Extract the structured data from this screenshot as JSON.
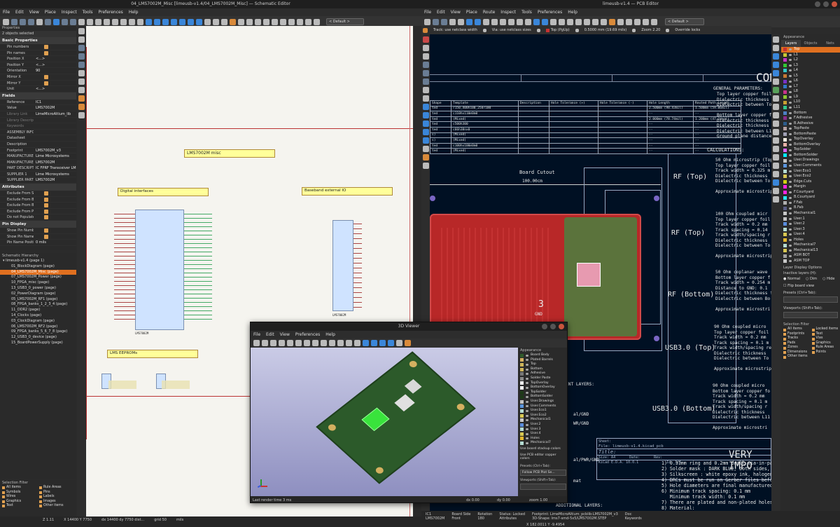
{
  "schematic": {
    "title": "04_LMS7002M_Misc [limeusb-v1.4/04_LMS7002M_Misc] — Schematic Editor",
    "menu": [
      "File",
      "Edit",
      "View",
      "Place",
      "Inspect",
      "Tools",
      "Preferences",
      "Help"
    ],
    "properties": {
      "header": "Properties",
      "selected": "2 objects selected",
      "basic_title": "Basic Properties",
      "basic": [
        {
          "k": "Pin numbers",
          "v": "",
          "check": true
        },
        {
          "k": "Pin names",
          "v": "",
          "check": true
        },
        {
          "k": "Position X",
          "v": "<...>"
        },
        {
          "k": "Position Y",
          "v": "<...>"
        },
        {
          "k": "Orientation",
          "v": "90"
        },
        {
          "k": "Mirror X",
          "v": "",
          "check": true
        },
        {
          "k": "Mirror Y",
          "v": "",
          "check": true
        },
        {
          "k": "Unit",
          "v": "<...>"
        }
      ],
      "fields_title": "Fields",
      "fields": [
        {
          "k": "Reference",
          "v": "IC1"
        },
        {
          "k": "Value",
          "v": "LMS7002M"
        },
        {
          "k": "Library Link",
          "v": "LimeMicroAltium_lib",
          "dim": true
        },
        {
          "k": "Library Description",
          "v": "",
          "dim": true
        },
        {
          "k": "Keywords",
          "v": "",
          "dim": true
        },
        {
          "k": "ASSEMBLY INFO",
          "v": ""
        },
        {
          "k": "Datasheet",
          "v": ""
        },
        {
          "k": "Description",
          "v": ""
        },
        {
          "k": "Footprint",
          "v": "LMS7002M_v3"
        },
        {
          "k": "MANUFACTURER",
          "v": "Lime Microsystems"
        },
        {
          "k": "MANUFACTURER PART",
          "v": "LMS7002M"
        },
        {
          "k": "PART DESCRIPTION",
          "v": "IC FPRF Transceiver LM"
        },
        {
          "k": "SUPPLIER 1",
          "v": "Lime Microsystems"
        },
        {
          "k": "SUPPLIER PART N",
          "v": "LMS7002M"
        }
      ],
      "attr_title": "Attributes",
      "attributes": [
        {
          "k": "Exclude From Sim",
          "v": "",
          "check": true
        },
        {
          "k": "Exclude From Bill",
          "v": "",
          "check": true
        },
        {
          "k": "Exclude From Board",
          "v": "",
          "check": true
        },
        {
          "k": "Exclude From Posi",
          "v": "",
          "check": true
        },
        {
          "k": "Do not Populate",
          "v": "",
          "check": true
        }
      ],
      "pin_title": "Pin Display",
      "pin_display": [
        {
          "k": "Show Pin Number",
          "v": "",
          "check": true
        },
        {
          "k": "Show Pin Name",
          "v": "",
          "check": true
        },
        {
          "k": "Pin Name Position",
          "v": "0 mils"
        }
      ]
    },
    "hierarchy": {
      "header": "Schematic Hierarchy",
      "root": "limeusb-v1.4 (page 1)",
      "items": [
        "01_BlockDiagram (page)",
        "04_LMS7002M_Misc (page)",
        "07_LMS7002M_Power (page)",
        "10_FPGA_misc (page)",
        "13_USB3_0_power (page)",
        "02_PowerDiagram (page)",
        "05_LMS7002M_RF1 (page)",
        "08_FPGA_banks_1_2_3_4 (page)",
        "11_DDR2 (page)",
        "14_Clocks (page)",
        "03_ClockDiagram (page)",
        "06_LMS7002M_RF2 (page)",
        "09_FPGA_banks_5_6_7_8 (page)",
        "12_USB3_0_device (page)",
        "15_BoardPowerSupply (page)"
      ],
      "selected_index": 1
    },
    "selection_filter": {
      "header": "Selection Filter",
      "items": [
        "All items",
        "Rule Areas",
        "Symbols",
        "Pins",
        "Wires",
        "Labels",
        "Graphics",
        "Images",
        "Text",
        "Other items"
      ]
    },
    "sheet_labels": {
      "misc": "LMS7002M misc",
      "digital": "Digital interfaces",
      "baseband": "Baseband external IO",
      "eeproms": "LMS EEPROMs"
    },
    "chip_labels": {
      "main": "LMS7002M",
      "baseband": "LMS7002M"
    },
    "status": [
      "Z 1.11",
      "X 14400 Y 7750",
      "dx 14400 dy 7750 dist...",
      "grid 50",
      "mils"
    ],
    "zoom_select": "< Default >"
  },
  "pcb": {
    "title": "limeusb-v1.4 — PCB Editor",
    "menu": [
      "File",
      "Edit",
      "View",
      "Place",
      "Route",
      "Inspect",
      "Tools",
      "Preferences",
      "Help"
    ],
    "toolbar": {
      "track": "Track: use netclass width",
      "via": "Via: use netclass sizes",
      "layer": "Top (PgUp)",
      "grid": "0.5000 mm (19.69 mils)",
      "zoom": "Zoom 2.20",
      "override": "Override locks",
      "default": "< Default >"
    },
    "appearance": {
      "header": "Appearance",
      "tabs": [
        "Layers",
        "Objects",
        "Nets"
      ],
      "layers": [
        {
          "n": "Top",
          "c": "#c83232"
        },
        {
          "n": "L1",
          "c": "#c8c832"
        },
        {
          "n": "L2",
          "c": "#c832c8"
        },
        {
          "n": "L3",
          "c": "#32c832"
        },
        {
          "n": "L4",
          "c": "#32c8c8"
        },
        {
          "n": "L5",
          "c": "#c87832"
        },
        {
          "n": "L6",
          "c": "#7832c8"
        },
        {
          "n": "L7",
          "c": "#3278c8"
        },
        {
          "n": "L8",
          "c": "#c8328c"
        },
        {
          "n": "L9",
          "c": "#8cc832"
        },
        {
          "n": "L10",
          "c": "#c8a032"
        },
        {
          "n": "L11",
          "c": "#32c88c"
        },
        {
          "n": "Bottom",
          "c": "#4d7fc4"
        },
        {
          "n": "F.Adhesive",
          "c": "#8b2d8b"
        },
        {
          "n": "B.Adhesive",
          "c": "#2d5c8b"
        },
        {
          "n": "TopPaste",
          "c": "#b4a0a0"
        },
        {
          "n": "BottomPaste",
          "c": "#a0a0b4"
        },
        {
          "n": "TopOverlay",
          "c": "#f2ede1"
        },
        {
          "n": "BottomOverlay",
          "c": "#e8b2a7"
        },
        {
          "n": "TopSolder",
          "c": "#d864ff"
        },
        {
          "n": "BottomSolder",
          "c": "#01f0ff"
        },
        {
          "n": "User.Drawings",
          "c": "#c2c2c2"
        },
        {
          "n": "User.Comments",
          "c": "#5994dc"
        },
        {
          "n": "User.Eco1",
          "c": "#b4dbd2"
        },
        {
          "n": "User.Eco2",
          "c": "#d8c852"
        },
        {
          "n": "Edge.Cuts",
          "c": "#d0d210"
        },
        {
          "n": "Margin",
          "c": "#ff26e2"
        },
        {
          "n": "F.Courtyard",
          "c": "#ff26e2"
        },
        {
          "n": "B.Courtyard",
          "c": "#26e9ff"
        },
        {
          "n": "F.Fab",
          "c": "#afafaf"
        },
        {
          "n": "B.Fab",
          "c": "#585d84"
        },
        {
          "n": "Mechanical1",
          "c": "#c8c8c8"
        },
        {
          "n": "User.1",
          "c": "#c2c2c2"
        },
        {
          "n": "User.2",
          "c": "#598cdc"
        },
        {
          "n": "User.3",
          "c": "#b4dbd2"
        },
        {
          "n": "User.4",
          "c": "#d8c852"
        },
        {
          "n": "Holes",
          "c": "#e3b72e"
        },
        {
          "n": "Mechanical7",
          "c": "#b4dbd2"
        },
        {
          "n": "Mechanical13",
          "c": "#d8c852"
        },
        {
          "n": "ASM BOT",
          "c": "#9f9f9f"
        },
        {
          "n": "ASM TOP",
          "c": "#c8c8c8"
        }
      ],
      "layer_options": "Layer Display Options",
      "inactive": "Inactive layers (H):",
      "inactive_opts": [
        "Normal",
        "Dim",
        "Hide"
      ],
      "flip": "Flip board view",
      "presets": "Presets (Ctrl+Tab):",
      "viewports": "Viewports (Shift+Tab):"
    },
    "selection_filter": {
      "header": "Selection Filter",
      "items": [
        "All items",
        "Locked items",
        "Footprints",
        "Text",
        "Tracks",
        "Vias",
        "Pads",
        "Graphics",
        "Zones",
        "Rule Areas",
        "Dimensions",
        "Points",
        "Other items"
      ]
    },
    "status_fields": [
      {
        "k": "IC1",
        "v": "LMS7002M"
      },
      {
        "k": "Board Side",
        "v": "Front"
      },
      {
        "k": "Rotation",
        "v": "180"
      },
      {
        "k": "Status: Locked",
        "v": "Attributes"
      },
      {
        "k": "Footprint: LimeMicroAltium_pcblib:LMS7002M_v3",
        "v": "3D-Shape: lms7-smd-5x5/LMS7002M.STEP"
      },
      {
        "k": "Doc",
        "v": "Keywords"
      }
    ],
    "coords": "X 182.0011  Y -9.4954",
    "table": {
      "headers": [
        "Shape",
        "Template",
        "Description",
        "Hole Tolerance (+)",
        "Hole Tolerance (-)",
        "Hole Length",
        "Routed Path Length"
      ],
      "rows": [
        [
          "ted",
          "r150_400h100_250r100",
          "",
          "",
          "",
          "2.500mm (98.43mil)",
          "1.500mm (59.06mil)"
        ],
        [
          "ted",
          "c110hx110m0m0",
          "",
          "",
          "",
          "--",
          "--"
        ],
        [
          "ted",
          "(Mixed)",
          "",
          "",
          "",
          "2.000mm (78.74mil)",
          "1.200mm (47.24mil)"
        ],
        [
          "ted",
          "c500h300",
          "",
          "",
          "",
          "--",
          "--"
        ],
        [
          "ted",
          "c66h38nx0",
          "",
          "",
          "",
          "--",
          "--"
        ],
        [
          "s)",
          "(Mixed)",
          "",
          "",
          "",
          "--",
          "--"
        ],
        [
          "s)",
          "(Mixed)",
          "",
          "",
          "",
          "--",
          "--"
        ],
        [
          "ted",
          "c100hx100m0m0",
          "",
          "",
          "",
          "--",
          "--"
        ],
        [
          "ted",
          "(Mixed)",
          "",
          "",
          "",
          "--",
          "--"
        ]
      ]
    },
    "drawing": {
      "con": "CON",
      "board_cutout": "Board Cutout",
      "dim": "100.00cm",
      "rf_top1": "RF (Top)",
      "rf_top2": "RF (Top)",
      "rf_bottom": "RF (Bottom)",
      "usb_top": "USB3.0 (Top)",
      "usb_bottom": "USB3.0 (Bottom)",
      "calculations": "CALCULATIONS:",
      "general": "GENERAL PARAMETERS:",
      "general_lines": "Top layer copper foil t\nDielectric thickness fr\nDielectric between Top\n\nBottom layer copper fo\nDielectric thickness fr\nDielectric thickness fr\nDielectric between L11\nGround plane distance",
      "n50": "50 Ohm microstrip (Top\nTop layer copper foil\nTrack width = 0.325 m\nDielectric thickness\nDielectric between To\n\nApproximate microstrip",
      "n100": "100 Ohm coupled micr\nTop layer copper foil\nTrack width = 0.2 mm\nTrack spacing = 0.14\nTrack width/spacing r\nDielectric thickness\nDielectric between To\n\nApproximate microstrip",
      "n50cpw": "50 Ohm coplanar wave\nBottom layer copper f\nTrack width = 0.254 m\nDistance to GND: 0.1\nDielectric thickness f\nDielectric between Bo\n\nApproximate microstri",
      "n90a": "90 Ohm coupled micro\nTop layer copper foil\nTrack width = 0.2 mm\nTrack spacing = 0.1 m\nTrack width/spacing re\nDielectric thickness\nDielectric between To\n\nApproximate microstrip",
      "n90b": "90 Ohm coupled micro\nBottom layer copper fo\nTrack width = 0.2 mm\nTrack spacing = 0.1 m\nTrack width/spacing r\nDielectric thickness\nDielectric between L11\n\nApproximate microstri",
      "layers_hdr": "ENT LAYERS:",
      "layer_lines": "al/GND\nWR/GND\n\n\n\nal/PWR/GND",
      "tb_sheet": "Sheet:",
      "tb_file": "File: limeusb-v1.4.kicad_pcb",
      "tb_title": "Title:",
      "tb_size": "Size: A4",
      "tb_date": "Date:",
      "tb_kicad": "KiCad E.D.A. 10.0.1",
      "tb_rev": "Rev:",
      "tb_id": "Id: 1/1",
      "very": "VERY IMPO",
      "very_lines": "1) 0.31mm ring and 0.2mm drill via-in-pad\n2) Solder mask : DARK BLUE, both sides, ha\n3) Silkscreen : white epoxy ink, halogen fre\n4) DRCs must be run on Gerber files before\n5) Hole diameters are final manufactured di\n6) Minimum track spacing: 0.1 mm\n   Minimum track width: 0.1 mm\n7) There are plated and non-plated holes on\n8) Material:\n   IT-180A\n   PCB vendor is to ensure UL and RoHS co",
      "additional": "ADDITIONAL LAYERS:",
      "mat": "mat",
      "num3": "3",
      "gnd": "GND"
    }
  },
  "viewer3d": {
    "title": "3D Viewer",
    "menu": [
      "File",
      "Edit",
      "View",
      "Preferences",
      "Help"
    ],
    "appearance": "Appearance",
    "layers": [
      {
        "n": "Board Body",
        "c": "#2f5a2a"
      },
      {
        "n": "Plated Barrels",
        "c": "#d4b060"
      },
      {
        "n": "Top",
        "c": "#cdb45a"
      },
      {
        "n": "Bottom",
        "c": "#cdb45a"
      },
      {
        "n": "Adhesive",
        "c": "#777777"
      },
      {
        "n": "Solder Paste",
        "c": "#888888"
      },
      {
        "n": "TopOverlay",
        "c": "#f0f0f0"
      },
      {
        "n": "BottomOverlay",
        "c": "#f0f0f0"
      },
      {
        "n": "TopSolder",
        "c": "#1d3a18"
      },
      {
        "n": "BottomSolder",
        "c": "#1d3a18"
      },
      {
        "n": "User.Drawings",
        "c": "#c2c2c2"
      },
      {
        "n": "User.Comments",
        "c": "#5994dc"
      },
      {
        "n": "User.Eco1",
        "c": "#b4dbd2"
      },
      {
        "n": "User.Eco2",
        "c": "#d8c852"
      },
      {
        "n": "Mechanical1",
        "c": "#c8c8c8"
      },
      {
        "n": "User.2",
        "c": "#598cdc"
      },
      {
        "n": "User.3",
        "c": "#b4dbd2"
      },
      {
        "n": "User.4",
        "c": "#d8c852"
      },
      {
        "n": "Holes",
        "c": "#e3b72e"
      },
      {
        "n": "Mechanical7",
        "c": "#b4dbd2"
      }
    ],
    "use_board_stackup": "Use board stackup colors",
    "use_pcb_copper": "Use PCB editor copper colors",
    "presets": "Presets (Ctrl+Tab):",
    "presets_value": "Follow PCB Plot Se...",
    "viewports": "Viewports (Shift+Tab):",
    "render_time": "Last render time 3 ms",
    "dx": "dx 0.00",
    "dy": "dy 0.00",
    "zoom": "zoom 1.00"
  },
  "colors": {
    "accent": "#e07020",
    "sheet": "#ffff9a",
    "pcb_bg": "#001023",
    "board_red": "#c03030"
  }
}
